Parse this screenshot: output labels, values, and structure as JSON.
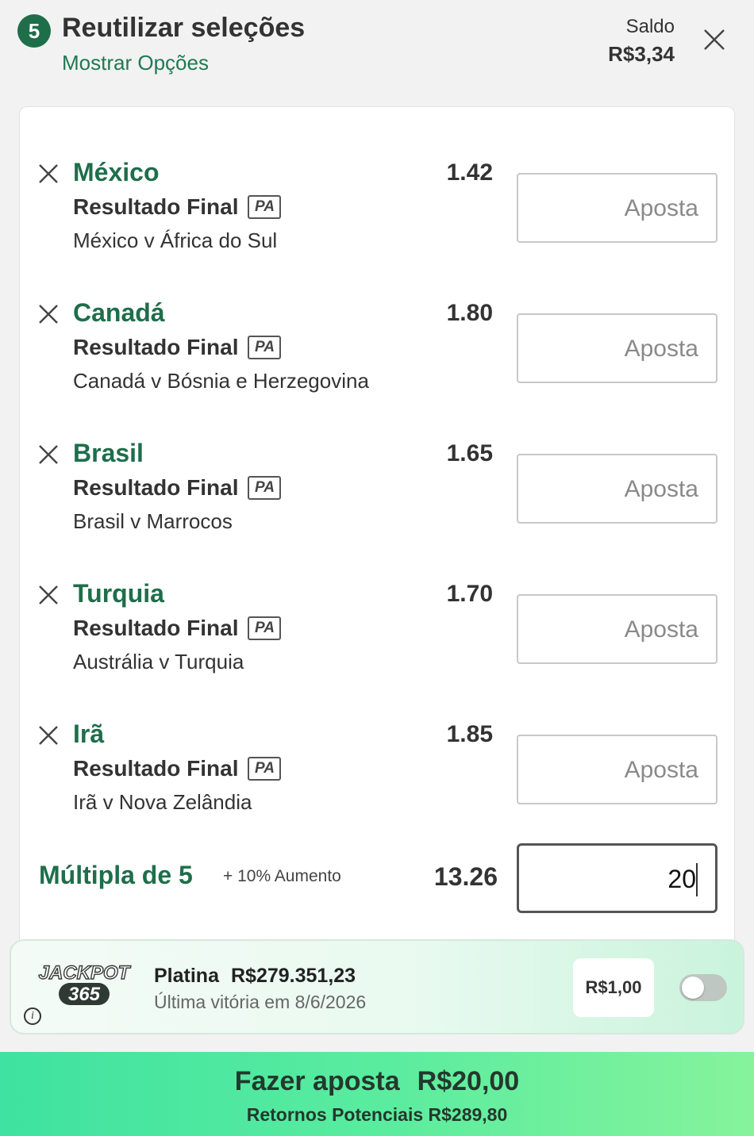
{
  "header": {
    "count": "5",
    "title": "Reutilizar seleções",
    "show_options": "Mostrar Opções",
    "balance_label": "Saldo",
    "balance_value": "R$3,34"
  },
  "selections": [
    {
      "team": "México",
      "market": "Resultado Final",
      "badge": "PA",
      "event": "México v África do Sul",
      "odds": "1.42",
      "stake_placeholder": "Aposta"
    },
    {
      "team": "Canadá",
      "market": "Resultado Final",
      "badge": "PA",
      "event": "Canadá v Bósnia e Herzegovina",
      "odds": "1.80",
      "stake_placeholder": "Aposta"
    },
    {
      "team": "Brasil",
      "market": "Resultado Final",
      "badge": "PA",
      "event": "Brasil v Marrocos",
      "odds": "1.65",
      "stake_placeholder": "Aposta"
    },
    {
      "team": "Turquia",
      "market": "Resultado Final",
      "badge": "PA",
      "event": "Austrália v Turquia",
      "odds": "1.70",
      "stake_placeholder": "Aposta"
    },
    {
      "team": "Irã",
      "market": "Resultado Final",
      "badge": "PA",
      "event": "Irã v Nova Zelândia",
      "odds": "1.85",
      "stake_placeholder": "Aposta"
    }
  ],
  "multiple": {
    "label": "Múltipla de 5",
    "boost": "+ 10% Aumento",
    "odds": "13.26",
    "stake": "20"
  },
  "jackpot": {
    "logo_text_top": "JACKPOT",
    "logo_text_bottom": "365",
    "tier": "Platina",
    "amount": "R$279.351,23",
    "last_win": "Última vitória em 8/6/2026",
    "price": "R$1,00",
    "info_icon": "i"
  },
  "bet_button": {
    "label": "Fazer aposta",
    "amount": "R$20,00",
    "returns": "Retornos Potenciais R$289,80"
  },
  "colors": {
    "brand_green": "#1e6e4a",
    "bet_gradient_start": "#3fe2a0",
    "bet_gradient_end": "#86f39b"
  }
}
